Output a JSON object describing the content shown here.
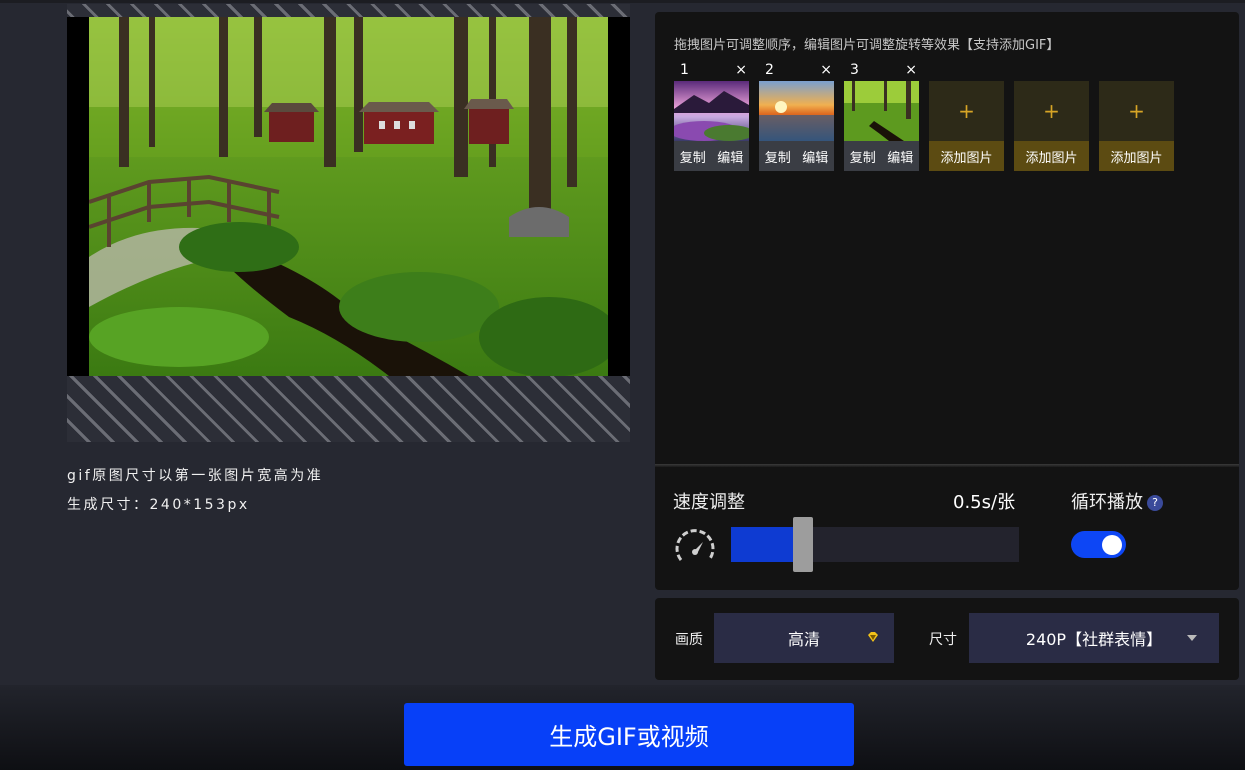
{
  "preview": {
    "info_line1": "gif原图尺寸以第一张图片宽高为准",
    "info_line2": "生成尺寸：240*153px"
  },
  "images_panel": {
    "hint": "拖拽图片可调整顺序，编辑图片可调整旋转等效果【支持添加GIF】",
    "thumbnails": [
      {
        "number": "1",
        "close": "×",
        "copy": "复制",
        "edit": "编辑",
        "scene": "purple-sunset-lake-flowers"
      },
      {
        "number": "2",
        "close": "×",
        "copy": "复制",
        "edit": "编辑",
        "scene": "orange-sunset-sea"
      },
      {
        "number": "3",
        "close": "×",
        "copy": "复制",
        "edit": "编辑",
        "scene": "green-forest-stream"
      }
    ],
    "add_slots": [
      {
        "plus": "+",
        "label": "添加图片"
      },
      {
        "plus": "+",
        "label": "添加图片"
      },
      {
        "plus": "+",
        "label": "添加图片"
      }
    ]
  },
  "speed": {
    "label": "速度调整",
    "value": "0.5s/张",
    "level": 0.25
  },
  "loop": {
    "label": "循环播放",
    "help": "?",
    "enabled": true
  },
  "quality": {
    "label": "画质",
    "value": "高清"
  },
  "size": {
    "label": "尺寸",
    "value": "240P【社群表情】"
  },
  "generate_button": "生成GIF或视频",
  "colors": {
    "accent": "#0740f8",
    "slider_fill": "#0e3bd2",
    "add_gold": "#d7a526",
    "panel_bg": "#131313"
  }
}
